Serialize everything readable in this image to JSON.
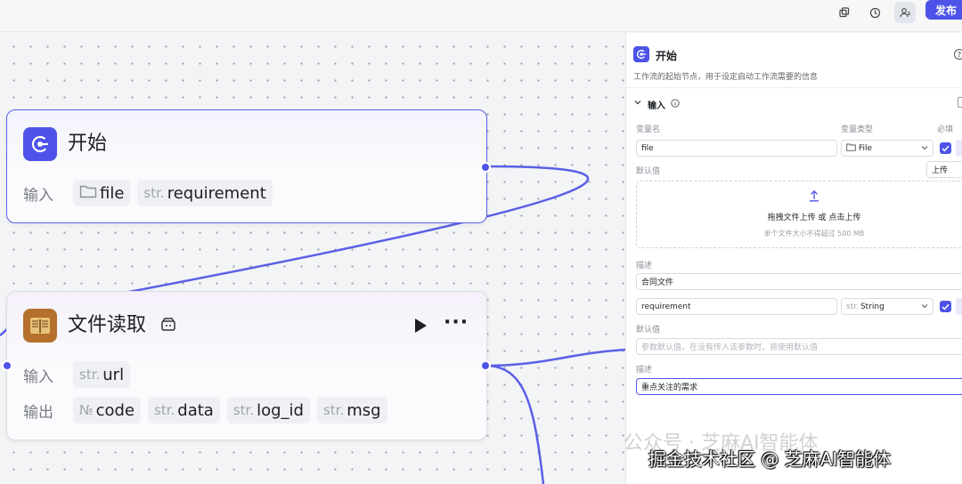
{
  "topbar": {
    "icons": [
      "copy-icon",
      "history-icon",
      "user-settings-icon"
    ],
    "publish_label": "发布"
  },
  "canvas": {
    "nodes": {
      "start": {
        "title": "开始",
        "input_label": "输入",
        "inputs": [
          {
            "prefix": "",
            "name": "file",
            "icon": "folder-icon"
          },
          {
            "prefix": "str.",
            "name": "requirement"
          }
        ]
      },
      "file_read": {
        "title": "文件读取",
        "input_label": "输入",
        "output_label": "输出",
        "inputs": [
          {
            "prefix": "str.",
            "name": "url"
          }
        ],
        "outputs": [
          {
            "prefix": "№",
            "name": "code"
          },
          {
            "prefix": "str.",
            "name": "data"
          },
          {
            "prefix": "str.",
            "name": "log_id"
          },
          {
            "prefix": "str.",
            "name": "msg"
          }
        ],
        "more_label": "···"
      }
    }
  },
  "panel": {
    "title": "开始",
    "help": "?",
    "description": "工作流的起始节点，用于设定启动工作流需要的信息",
    "section_title": "输入",
    "columns": {
      "name": "变量名",
      "type": "变量类型",
      "required": "必填"
    },
    "variables": [
      {
        "name": "file",
        "type": "File",
        "default_label": "默认值",
        "default_mode": "上传",
        "upload_main": "拖拽文件上传 或 点击上传",
        "upload_sub": "单个文件大小不得超过 500 MB",
        "desc_label": "描述",
        "desc_value": "合同文件"
      },
      {
        "name": "requirement",
        "type_prefix": "str.",
        "type": "String",
        "default_label": "默认值",
        "default_placeholder": "参数默认值，在没有传入该参数时，将使用默认值",
        "desc_label": "描述",
        "desc_value": "重点关注的需求"
      }
    ]
  },
  "watermark": {
    "line1": "公众号 · 芝麻AI智能体",
    "line2": "掘金技术社区 @ 芝麻AI智能体"
  },
  "colors": {
    "accent": "#4d53e8",
    "edge": "#5a60e6"
  }
}
